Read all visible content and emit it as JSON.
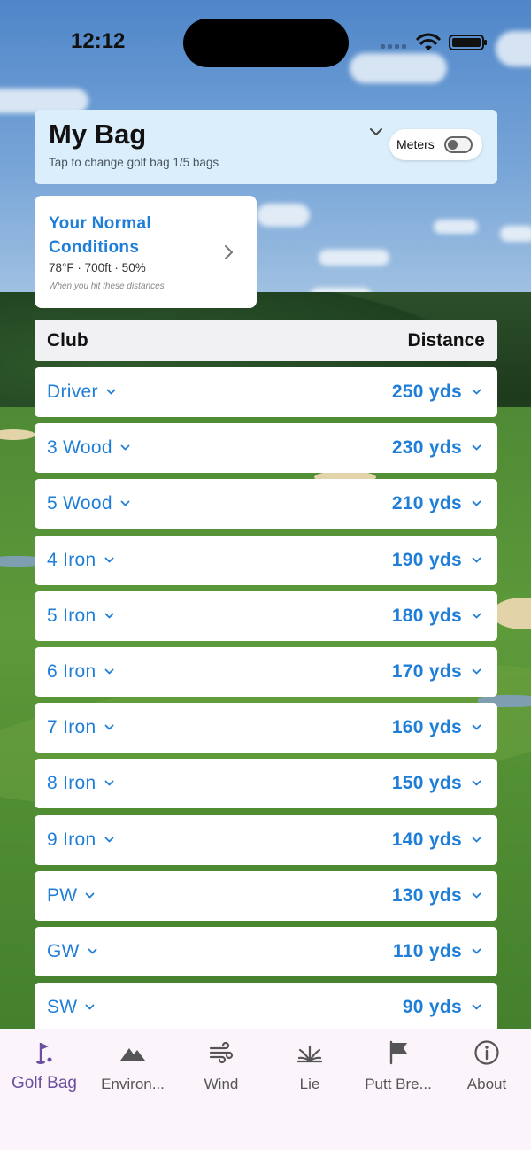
{
  "status_bar": {
    "time": "12:12"
  },
  "bag": {
    "title": "My Bag",
    "subtitle": "Tap to change golf bag 1/5 bags",
    "units_toggle_label": "Meters",
    "units_toggle_on": false
  },
  "conditions": {
    "title": "Your Normal Conditions",
    "values": "78°F · 700ft · 50%",
    "note": "When you hit these distances"
  },
  "table": {
    "club_header": "Club",
    "distance_header": "Distance",
    "rows": [
      {
        "club": "Driver",
        "distance": "250 yds"
      },
      {
        "club": "3 Wood",
        "distance": "230 yds"
      },
      {
        "club": "5 Wood",
        "distance": "210 yds"
      },
      {
        "club": "4 Iron",
        "distance": "190 yds"
      },
      {
        "club": "5 Iron",
        "distance": "180 yds"
      },
      {
        "club": "6 Iron",
        "distance": "170 yds"
      },
      {
        "club": "7 Iron",
        "distance": "160 yds"
      },
      {
        "club": "8 Iron",
        "distance": "150 yds"
      },
      {
        "club": "9 Iron",
        "distance": "140 yds"
      },
      {
        "club": "PW",
        "distance": "130 yds"
      },
      {
        "club": "GW",
        "distance": "110 yds"
      },
      {
        "club": "SW",
        "distance": "90 yds"
      }
    ]
  },
  "tabs": [
    {
      "label": "Golf Bag",
      "icon": "golf-flag-icon",
      "active": true
    },
    {
      "label": "Environ...",
      "icon": "mountain-icon",
      "active": false
    },
    {
      "label": "Wind",
      "icon": "wind-icon",
      "active": false
    },
    {
      "label": "Lie",
      "icon": "grass-icon",
      "active": false
    },
    {
      "label": "Putt Bre...",
      "icon": "flag-icon",
      "active": false
    },
    {
      "label": "About",
      "icon": "info-icon",
      "active": false
    }
  ],
  "colors": {
    "accent": "#1f7ed8",
    "active_tab": "#6a4f9e",
    "header_card": "#dbeefb",
    "tab_bar": "#fbf4fb"
  }
}
